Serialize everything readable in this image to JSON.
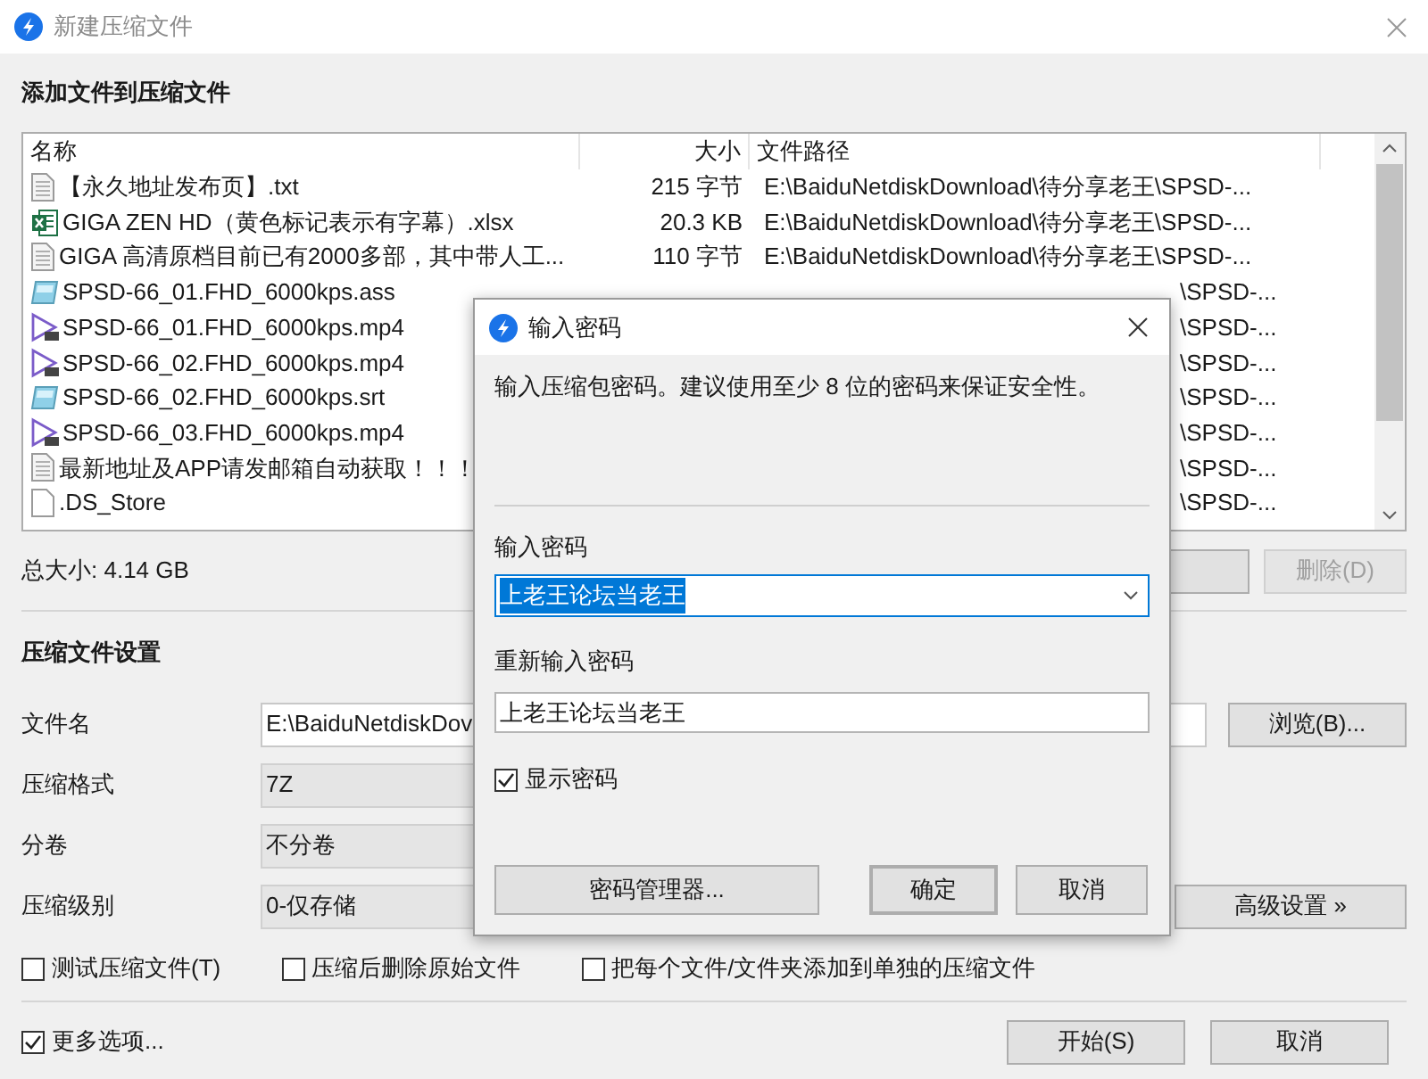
{
  "window": {
    "title": "新建压缩文件"
  },
  "add_section": {
    "heading": "添加文件到压缩文件"
  },
  "file_list": {
    "columns": [
      "名称",
      "大小",
      "文件路径"
    ],
    "rows": [
      {
        "kind": "text",
        "name": "【永久地址发布页】.txt",
        "size": "215 字节",
        "path": "E:\\BaiduNetdiskDownload\\待分享老王\\SPSD-..."
      },
      {
        "kind": "sheet",
        "name": "GIGA ZEN HD（黄色标记表示有字幕）.xlsx",
        "size": "20.3 KB",
        "path": "E:\\BaiduNetdiskDownload\\待分享老王\\SPSD-..."
      },
      {
        "kind": "text",
        "name": "GIGA 高清原档目前已有2000多部，其中带人工...",
        "size": "110 字节",
        "path": "E:\\BaiduNetdiskDownload\\待分享老王\\SPSD-..."
      },
      {
        "kind": "subtitle",
        "name": "SPSD-66_01.FHD_6000kps.ass",
        "path": "\\SPSD-..."
      },
      {
        "kind": "video",
        "name": "SPSD-66_01.FHD_6000kps.mp4",
        "path": "\\SPSD-..."
      },
      {
        "kind": "video",
        "name": "SPSD-66_02.FHD_6000kps.mp4",
        "path": "\\SPSD-..."
      },
      {
        "kind": "subtitle",
        "name": "SPSD-66_02.FHD_6000kps.srt",
        "path": "\\SPSD-..."
      },
      {
        "kind": "video",
        "name": "SPSD-66_03.FHD_6000kps.mp4",
        "path": "\\SPSD-..."
      },
      {
        "kind": "text",
        "name": "最新地址及APP请发邮箱自动获取！！！",
        "path": "\\SPSD-..."
      },
      {
        "kind": "blank",
        "name": ".DS_Store",
        "path": "\\SPSD-..."
      }
    ]
  },
  "total_size": "总大小: 4.14 GB",
  "delete_button": {
    "label": "删除(D)",
    "disabled": true
  },
  "settings": {
    "heading": "压缩文件设置",
    "filename": {
      "label": "文件名",
      "value": "E:\\BaiduNetdiskDov"
    },
    "browse_button": "浏览(B)...",
    "format": {
      "label": "压缩格式",
      "value": "7Z"
    },
    "split": {
      "label": "分卷",
      "value": "不分卷"
    },
    "level": {
      "label": "压缩级别",
      "value": "0-仅存储"
    },
    "advanced_button": "高级设置 »",
    "options": [
      {
        "label": "测试压缩文件(T)",
        "checked": false
      },
      {
        "label": "压缩后删除原始文件",
        "checked": false
      },
      {
        "label": "把每个文件/文件夹添加到单独的压缩文件",
        "checked": false
      }
    ]
  },
  "more_options": {
    "label": "更多选项...",
    "checked": true
  },
  "buttons": [
    "开始(S)",
    "取消"
  ],
  "password_dialog": {
    "title": "输入密码",
    "message": "输入压缩包密码。建议使用至少 8 位的密码来保证安全性。",
    "password_label": "输入密码",
    "password": "上老王论坛当老王",
    "password_selected": true,
    "confirm_label": "重新输入密码",
    "confirm": "上老王论坛当老王",
    "show_password": {
      "label": "显示密码",
      "checked": true
    },
    "buttons": [
      "密码管理器...",
      "确定",
      "取消"
    ]
  }
}
